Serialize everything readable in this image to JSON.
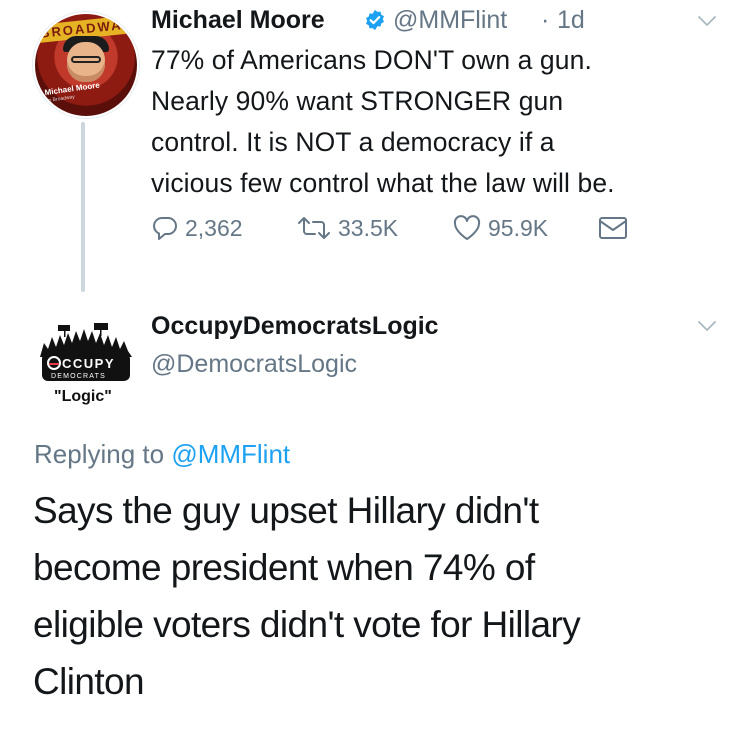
{
  "tweet1": {
    "author_name": "Michael Moore",
    "handle": "@MMFlint",
    "separator": "·",
    "time": "1d",
    "avatar_text": {
      "band": "BROADWAY",
      "name": "Michael Moore",
      "sub": "on Broadway"
    },
    "text_lines": [
      "77% of Americans DON'T own a gun.",
      "Nearly 90% want STRONGER gun",
      "control. It is NOT a democracy if a",
      "vicious few control what the law will be."
    ],
    "actions": {
      "replies": "2,362",
      "retweets": "33.5K",
      "likes": "95.9K"
    },
    "icons": [
      "verified-badge-icon",
      "chevron-down-icon",
      "reply-icon",
      "retweet-icon",
      "heart-icon",
      "envelope-icon"
    ]
  },
  "tweet2": {
    "author_name": "OccupyDemocratsLogic",
    "handle": "@DemocratsLogic",
    "avatar_text": {
      "logo": "CCUPY",
      "logo_sub": "DEMOCRATS",
      "tag": "\"Logic\""
    },
    "replying_prefix": "Replying to",
    "replying_to": "@MMFlint",
    "text_lines": [
      "Says the guy upset Hillary didn't",
      "become president when 74% of",
      "eligible voters didn't vote for Hillary",
      "Clinton"
    ]
  },
  "colors": {
    "text": "#14171a",
    "secondary": "#657786",
    "link": "#1da1f2",
    "verified": "#1da1f2",
    "thread_line": "#ccd6dd"
  }
}
